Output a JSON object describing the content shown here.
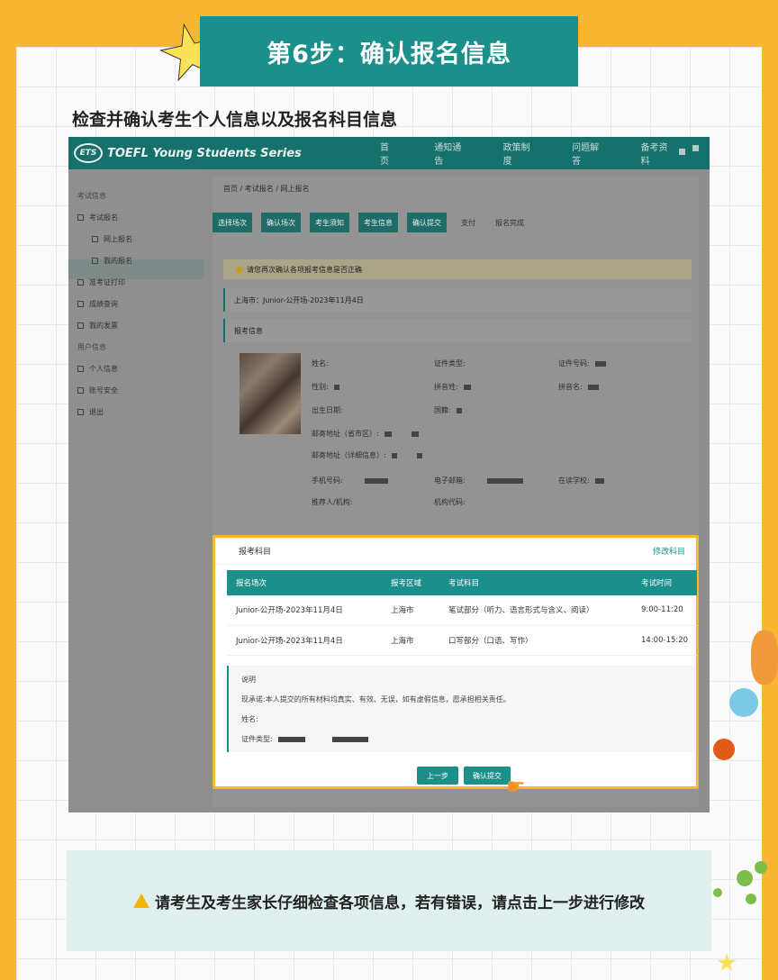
{
  "banner": {
    "title": "第6步：确认报名信息"
  },
  "subtitle": "检查并确认考生个人信息以及报名科目信息",
  "app": {
    "logo": "ETS",
    "brand": "TOEFL Young Students Series",
    "nav": [
      "首页",
      "通知通告",
      "政策制度",
      "问题解答",
      "备考资料"
    ]
  },
  "sidebar": {
    "section1": "考试信息",
    "items": [
      "考试报名",
      "网上报名",
      "我的报名",
      "准考证打印",
      "成绩查询",
      "我的发票"
    ],
    "section2": "用户信息",
    "items2": [
      "个人信息",
      "账号安全",
      "退出"
    ]
  },
  "breadcrumb": "首页 / 考试报名 / 网上报名",
  "steps": [
    "选择场次",
    "确认场次",
    "考生须知",
    "考生信息",
    "确认提交",
    "支付",
    "报名完成"
  ],
  "notice": "请您再次确认各项报考信息是否正确",
  "session_line": "上海市：Junior-公开场-2023年11月4日",
  "section_title": "报考信息",
  "fields": {
    "name": "姓名:",
    "id_type": "证件类型:",
    "id_no": "证件号码:",
    "gender": "性别:",
    "pinyin_last": "拼音姓:",
    "pinyin_first": "拼音名:",
    "birth": "出生日期:",
    "nationality": "国籍:",
    "address_city": "邮寄地址（省市区）:",
    "address_detail": "邮寄地址（详细信息）:",
    "phone": "手机号码:",
    "email": "电子邮箱:",
    "school": "在读学校:",
    "referrer": "推荐人/机构:",
    "org_code": "机构代码:"
  },
  "panel": {
    "title": "报考科目",
    "edit_link": "修改科目",
    "columns": [
      "报名场次",
      "报考区域",
      "考试科目",
      "考试时间"
    ],
    "rows": [
      [
        "Junior-公开场-2023年11月4日",
        "上海市",
        "笔试部分（听力、语言形式与含义、阅读）",
        "9:00-11:20"
      ],
      [
        "Junior-公开场-2023年11月4日",
        "上海市",
        "口写部分（口语、写作）",
        "14:00-15:20"
      ]
    ],
    "note_title": "说明",
    "note_text": "现承诺:本人提交的所有材料均真实、有效、无误，如有虚假信息，愿承担相关责任。",
    "note_name": "姓名:",
    "note_id": "证件类型:",
    "btn_prev": "上一步",
    "btn_submit": "确认提交"
  },
  "tip": "请考生及考生家长仔细检查各项信息，若有错误，请点击上一步进行修改",
  "colors": {
    "teal": "#1b8f89",
    "frame": "#f7b733",
    "highlight": "#f5b82a"
  }
}
